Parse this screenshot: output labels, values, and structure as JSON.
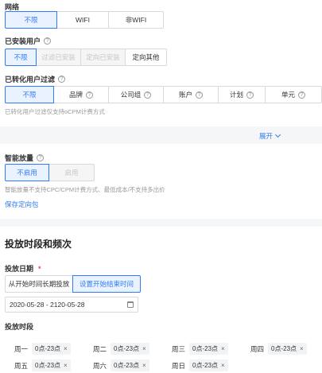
{
  "network": {
    "title": "网络",
    "options": [
      "不限",
      "WIFI",
      "非WIFI"
    ]
  },
  "installed": {
    "title": "已安装用户",
    "options": [
      "不限",
      "过滤已安装",
      "定向已安装",
      "定向其他"
    ]
  },
  "converted": {
    "title": "已转化用户过滤",
    "options": [
      "不限",
      "品牌",
      "公司组",
      "账户",
      "计划",
      "单元"
    ],
    "note": "已转化用户过滤仅支持oCPM计费方式",
    "expand_label": "展开"
  },
  "smart": {
    "title": "智能放量",
    "options": [
      "不启用",
      "启用"
    ],
    "note": "智能放量不支持CPC/CPM计费方式、最低成本/不支持多出价"
  },
  "save_link": "保存定向包",
  "schedule": {
    "title": "投放时段和频次",
    "date_label": "投放日期",
    "required_mark": "*",
    "date_options": [
      "从开始时间长期投放",
      "设置开始结束时间"
    ],
    "date_value": "2020-05-28 - 2120-05-28",
    "period_label": "投放时段",
    "days": [
      {
        "name": "周一",
        "range": "0点-23点"
      },
      {
        "name": "周二",
        "range": "0点-23点"
      },
      {
        "name": "周三",
        "range": "0点-23点"
      },
      {
        "name": "周四",
        "range": "0点-23点"
      },
      {
        "name": "周五",
        "range": "0点-23点"
      },
      {
        "name": "周六",
        "range": "0点-23点"
      },
      {
        "name": "周日",
        "range": "0点-23点"
      }
    ],
    "remove_glyph": "×"
  },
  "help_glyph": "?",
  "colors": {
    "accent": "#2f7cf6",
    "required": "#e94c4c",
    "section_bg": "#f5f6f8"
  }
}
